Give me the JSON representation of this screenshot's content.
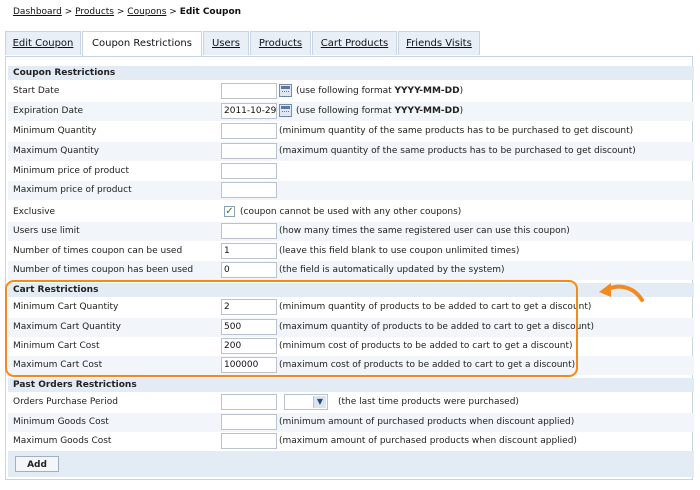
{
  "breadcrumb": {
    "items": [
      "Dashboard",
      "Products",
      "Coupons"
    ],
    "current": "Edit Coupon",
    "sep": ">"
  },
  "tabs": [
    {
      "label": "Edit Coupon",
      "active": false
    },
    {
      "label": "Coupon Restrictions",
      "active": true
    },
    {
      "label": "Users",
      "active": false
    },
    {
      "label": "Products",
      "active": false
    },
    {
      "label": "Cart Products",
      "active": false
    },
    {
      "label": "Friends Visits",
      "active": false
    }
  ],
  "sections": {
    "coupon": "Coupon Restrictions",
    "cart": "Cart Restrictions",
    "past": "Past Orders Restrictions"
  },
  "fields": {
    "start_date": {
      "label": "Start Date",
      "value": "",
      "note_pre": "(use following format ",
      "format": "YYYY-MM-DD",
      "note_post": ")"
    },
    "expiration_date": {
      "label": "Expiration Date",
      "value": "2011-10-29",
      "note_pre": "(use following format ",
      "format": "YYYY-MM-DD",
      "note_post": ")"
    },
    "min_quantity": {
      "label": "Minimum Quantity",
      "value": "",
      "note": "(minimum quantity of the same products has to be purchased to get discount)"
    },
    "max_quantity": {
      "label": "Maximum Quantity",
      "value": "",
      "note": "(maximum quantity of the same products has to be purchased to get discount)"
    },
    "min_price": {
      "label": "Minimum price of product",
      "value": ""
    },
    "max_price": {
      "label": "Maximum price of product",
      "value": ""
    },
    "exclusive": {
      "label": "Exclusive",
      "checked": true,
      "note": "(coupon cannot be used with any other coupons)"
    },
    "users_use_limit": {
      "label": "Users use limit",
      "value": "",
      "note": "(how many times the same registered user can use this coupon)"
    },
    "times_can_be_used": {
      "label": "Number of times coupon can be used",
      "value": "1",
      "note": "(leave this field blank to use coupon unlimited times)"
    },
    "times_has_been_used": {
      "label": "Number of times coupon has been used",
      "value": "0",
      "note": "(the field is automatically updated by the system)"
    },
    "min_cart_quantity": {
      "label": "Minimum Cart Quantity",
      "value": "2",
      "note": "(minimum quantity of products to be added to cart to get a discount)"
    },
    "max_cart_quantity": {
      "label": "Maximum Cart Quantity",
      "value": "500",
      "note": "(maximum quantity of products to be added to cart to get a discount)"
    },
    "min_cart_cost": {
      "label": "Minimum Cart Cost",
      "value": "200",
      "note": "(minimum cost of products to be added to cart to get a discount)"
    },
    "max_cart_cost": {
      "label": "Maximum Cart Cost",
      "value": "100000",
      "note": "(maximum cost of products to be added to cart to get a discount)"
    },
    "orders_period": {
      "label": "Orders Purchase Period",
      "value": "",
      "select_value": "",
      "note": "(the last time products were purchased)"
    },
    "min_goods_cost": {
      "label": "Minimum Goods Cost",
      "value": "",
      "note": "(minimum amount of purchased products when discount applied)"
    },
    "max_goods_cost": {
      "label": "Maximum Goods Cost",
      "value": "",
      "note": "(maximum amount of purchased products when discount applied)"
    }
  },
  "add_button": "Add",
  "colors": {
    "highlight": "#f28a1e",
    "section_bg": "#e3ebf4",
    "border": "#c8d4e2"
  }
}
